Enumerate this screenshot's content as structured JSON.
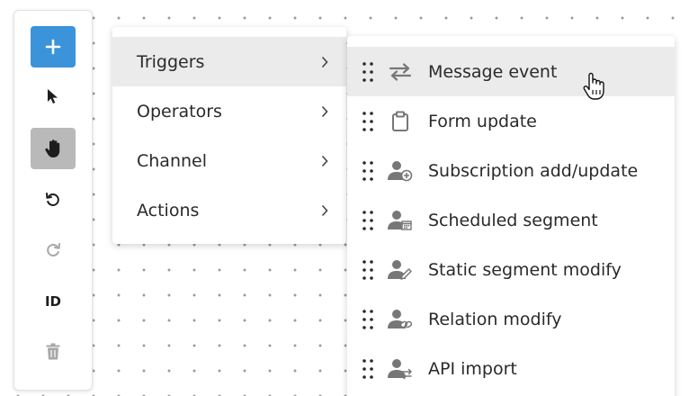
{
  "toolbar": {
    "add_icon": "plus-icon",
    "pointer_icon": "pointer-arrow-icon",
    "hand_icon": "hand-pan-icon",
    "undo_icon": "undo-icon",
    "redo_icon": "redo-icon",
    "id_label": "ID",
    "delete_icon": "trash-icon",
    "accent_color": "#3b93d9",
    "active_tool_color": "#b9b9b9"
  },
  "menu": {
    "items": [
      {
        "label": "Triggers",
        "active": true
      },
      {
        "label": "Operators"
      },
      {
        "label": "Channel"
      },
      {
        "label": "Actions"
      }
    ]
  },
  "submenu": {
    "items": [
      {
        "label": "Message event",
        "icon": "swap-arrows-icon",
        "hover": true
      },
      {
        "label": "Form update",
        "icon": "clipboard-icon"
      },
      {
        "label": "Subscription add/update",
        "icon": "user-add-icon"
      },
      {
        "label": "Scheduled segment",
        "icon": "user-calendar-icon"
      },
      {
        "label": "Static segment modify",
        "icon": "user-edit-icon"
      },
      {
        "label": "Relation modify",
        "icon": "user-link-icon"
      },
      {
        "label": "API import",
        "icon": "user-import-icon"
      }
    ]
  }
}
